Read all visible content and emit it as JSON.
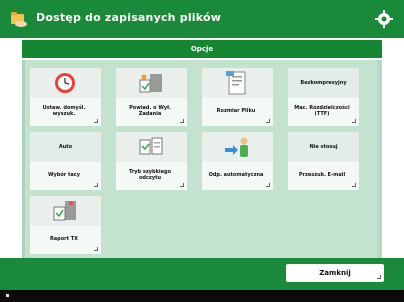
{
  "header": {
    "title": "Dostęp do zapisanych plików",
    "icon": "folder-hand-icon",
    "settings_icon": "gear-icon",
    "accent": "#1a8a3a"
  },
  "subheader": {
    "label": "Opcje"
  },
  "tiles": [
    {
      "label": "Ustaw. domyśl. wyszuk."
    },
    {
      "label": "Powiad. o Wył. Zadania"
    },
    {
      "label": "Rozmiar Pliku"
    },
    {
      "top_label": "Bezkompresyjny",
      "label": "Mac. Rozdzielczości (TTF)"
    },
    {
      "top_label": "Auto",
      "label": "Wybór tacy"
    },
    {
      "label": "Tryb szybkiego odczytu"
    },
    {
      "label": "Odp. automatyczna"
    },
    {
      "top_label": "Nie stosuj",
      "label": "Przeszuk. E-mail"
    },
    {
      "label": "Raport TX"
    }
  ],
  "footer": {
    "close_label": "Zamknij"
  }
}
